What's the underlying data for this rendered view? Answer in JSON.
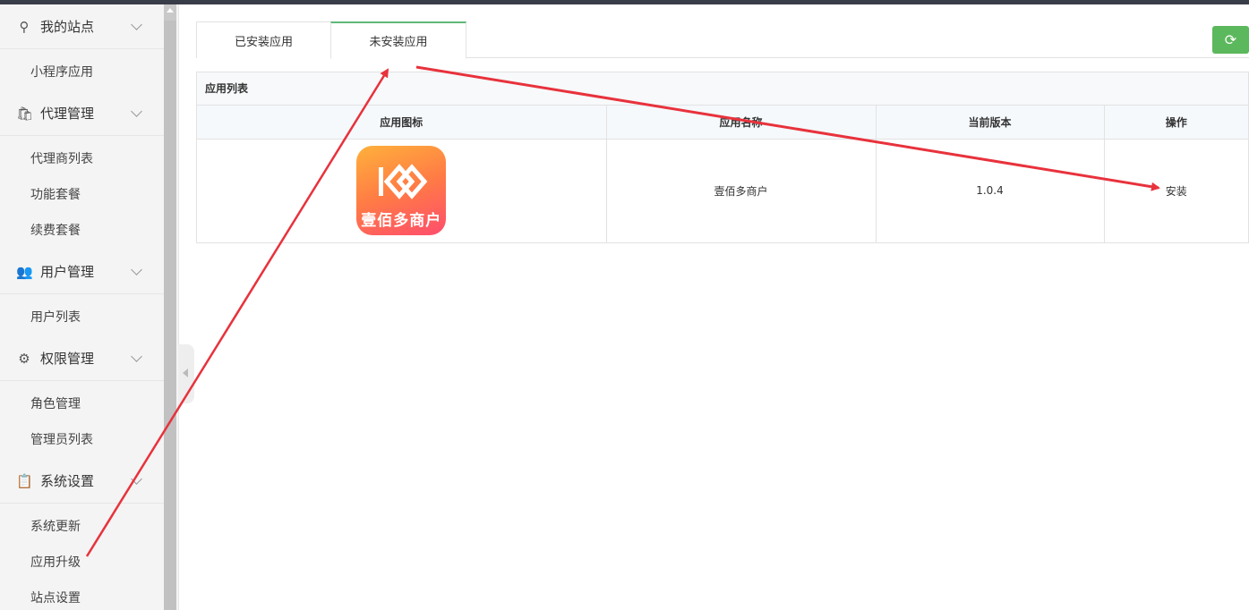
{
  "sidebar": {
    "groups": [
      {
        "label": "我的站点",
        "icon": "user-pin-icon",
        "items": [
          "小程序应用"
        ]
      },
      {
        "label": "代理管理",
        "icon": "bag-icon",
        "items": [
          "代理商列表",
          "功能套餐",
          "续费套餐"
        ]
      },
      {
        "label": "用户管理",
        "icon": "users-icon",
        "items": [
          "用户列表"
        ]
      },
      {
        "label": "权限管理",
        "icon": "gear-icon",
        "items": [
          "角色管理",
          "管理员列表"
        ]
      },
      {
        "label": "系统设置",
        "icon": "clipboard-icon",
        "items": [
          "系统更新",
          "应用升级",
          "站点设置"
        ]
      }
    ]
  },
  "tabs": {
    "installed": "已安装应用",
    "not_installed": "未安装应用",
    "active": "未安装应用"
  },
  "panel": {
    "title": "应用列表",
    "columns": [
      "应用图标",
      "应用名称",
      "当前版本",
      "操作"
    ],
    "rows": [
      {
        "icon_text": "壹佰多商户",
        "name": "壹佰多商户",
        "version": "1.0.4",
        "action": "安装"
      }
    ]
  },
  "colors": {
    "accent": "#5cb85c",
    "annotation_arrow": "#e8323c"
  }
}
